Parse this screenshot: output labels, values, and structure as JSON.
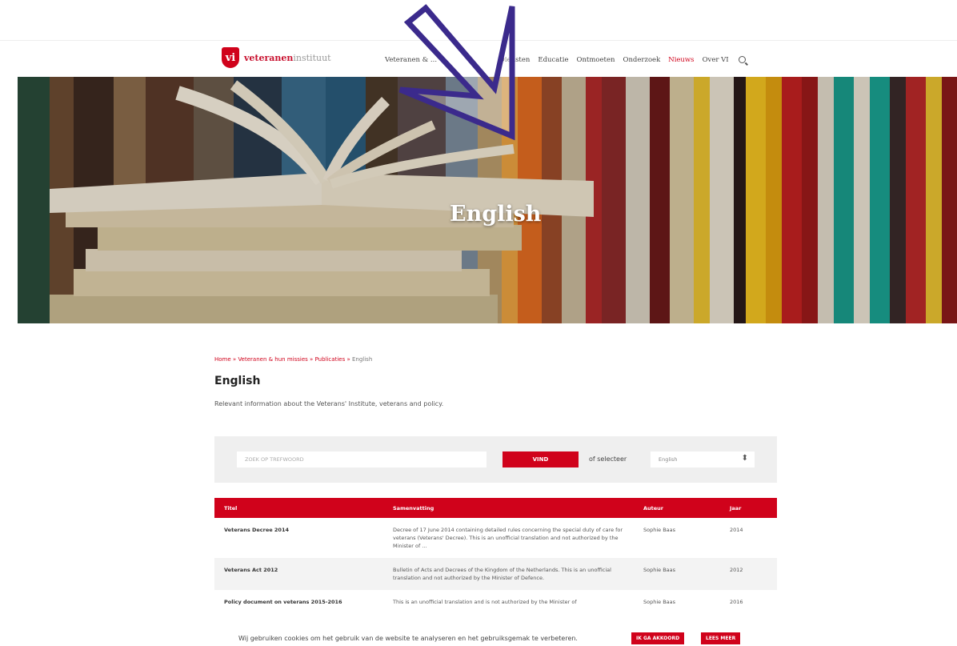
{
  "header": {
    "logo_mark": "vi",
    "logo_text_a": "veteranen",
    "logo_text_b": "instituut",
    "nav": [
      "Veteranen & ...",
      "Diensten",
      "Educatie",
      "Ontmoeten",
      "Onderzoek",
      "Nieuws",
      "Over VI"
    ],
    "active_nav": "Nieuws"
  },
  "hero": {
    "title": "English"
  },
  "breadcrumb": {
    "home": "Home",
    "level1": "Veteranen & hun missies",
    "level2": "Publicaties",
    "current": "English",
    "separator": "»"
  },
  "main": {
    "title": "English",
    "intro": "Relevant information about the Veterans' Institute, veterans and policy."
  },
  "filter": {
    "search_placeholder": "ZOEK OP TREFWOORD",
    "search_button": "VIND",
    "or_select_label": "of selecteer",
    "select_value": "English"
  },
  "table": {
    "headers": [
      "Titel",
      "Samenvatting",
      "Auteur",
      "Jaar"
    ],
    "rows": [
      {
        "title": "Veterans Decree 2014",
        "summary": "Decree of 17 June 2014 containing detailed rules concerning the special duty of care for veterans (Veterans' Decree). This is an unofficial translation and not authorized by the Minister of ...",
        "author": "Sophie Baas",
        "year": "2014"
      },
      {
        "title": "Veterans Act 2012",
        "summary": "Bulletin of Acts and Decrees of the Kingdom of the Netherlands. This is an unofficial translation and not authorized by the Minister of Defence.",
        "author": "Sophie Baas",
        "year": "2012"
      },
      {
        "title": "Policy document on veterans 2015-2016",
        "summary": "This is an unofficial translation and is not authorized by the Minister of",
        "author": "Sophie Baas",
        "year": "2016"
      }
    ]
  },
  "cookie": {
    "text": "Wij gebruiken cookies om het gebruik van de website te analyseren en het gebruiksgemak te verbeteren.",
    "accept": "IK GA AKKOORD",
    "more": "LEES MEER"
  },
  "colors": {
    "brand_red": "#d0021b",
    "arrow_purple": "#3b2a8c"
  },
  "icons": [
    "search-icon",
    "arrow-annotation-icon",
    "dropdown-caret-icon"
  ]
}
